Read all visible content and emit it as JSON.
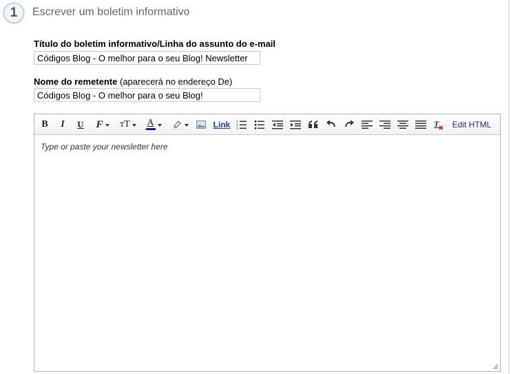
{
  "step": {
    "number": "1",
    "title": "Escrever um boletim informativo"
  },
  "subject_field": {
    "label": "Título do boletim informativo/Linha do assunto do e-mail",
    "value": "Códigos Blog - O melhor para o seu Blog! Newsletter"
  },
  "sender_field": {
    "label": "Nome do remetente",
    "hint": "(aparecerá no endereço De)",
    "value": "Códigos Blog - O melhor para o seu Blog!"
  },
  "toolbar": {
    "bold": "B",
    "italic": "I",
    "underline": "U",
    "font_family": "F",
    "font_size": "тT",
    "text_color_glyph": "A",
    "link_label": "Link",
    "edit_html_label": "Edit HTML",
    "text_color": "#1a1aa0",
    "highlight_color": "#ffffff"
  },
  "editor": {
    "placeholder": "Type or paste your newsletter here"
  }
}
